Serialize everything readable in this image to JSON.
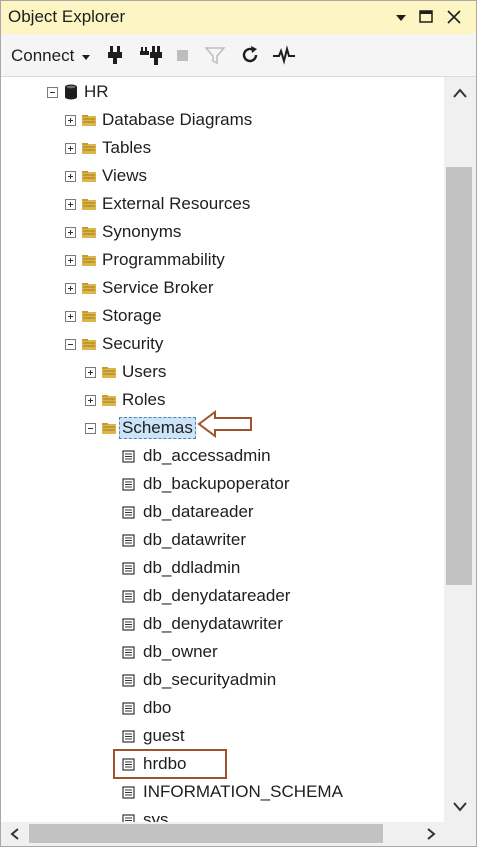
{
  "window": {
    "title": "Object Explorer",
    "connect_label": "Connect"
  },
  "toolbar": {
    "icons": [
      "connect-icon",
      "disconnect-icon",
      "stop-icon",
      "filter-icon",
      "refresh-icon",
      "activity-monitor-icon"
    ]
  },
  "tree": {
    "database": "HR",
    "folders": {
      "database_diagrams": "Database Diagrams",
      "tables": "Tables",
      "views": "Views",
      "external_resources": "External Resources",
      "synonyms": "Synonyms",
      "programmability": "Programmability",
      "service_broker": "Service Broker",
      "storage": "Storage",
      "security": "Security",
      "users": "Users",
      "roles": "Roles",
      "schemas": "Schemas"
    },
    "schemas": [
      "db_accessadmin",
      "db_backupoperator",
      "db_datareader",
      "db_datawriter",
      "db_ddladmin",
      "db_denydatareader",
      "db_denydatawriter",
      "db_owner",
      "db_securityadmin",
      "dbo",
      "guest",
      "hrdbo",
      "INFORMATION_SCHEMA",
      "sys"
    ]
  },
  "colors": {
    "title_bar": "#fdf5c4",
    "selection": "#cce4f7",
    "annotation": "#a0522d"
  }
}
